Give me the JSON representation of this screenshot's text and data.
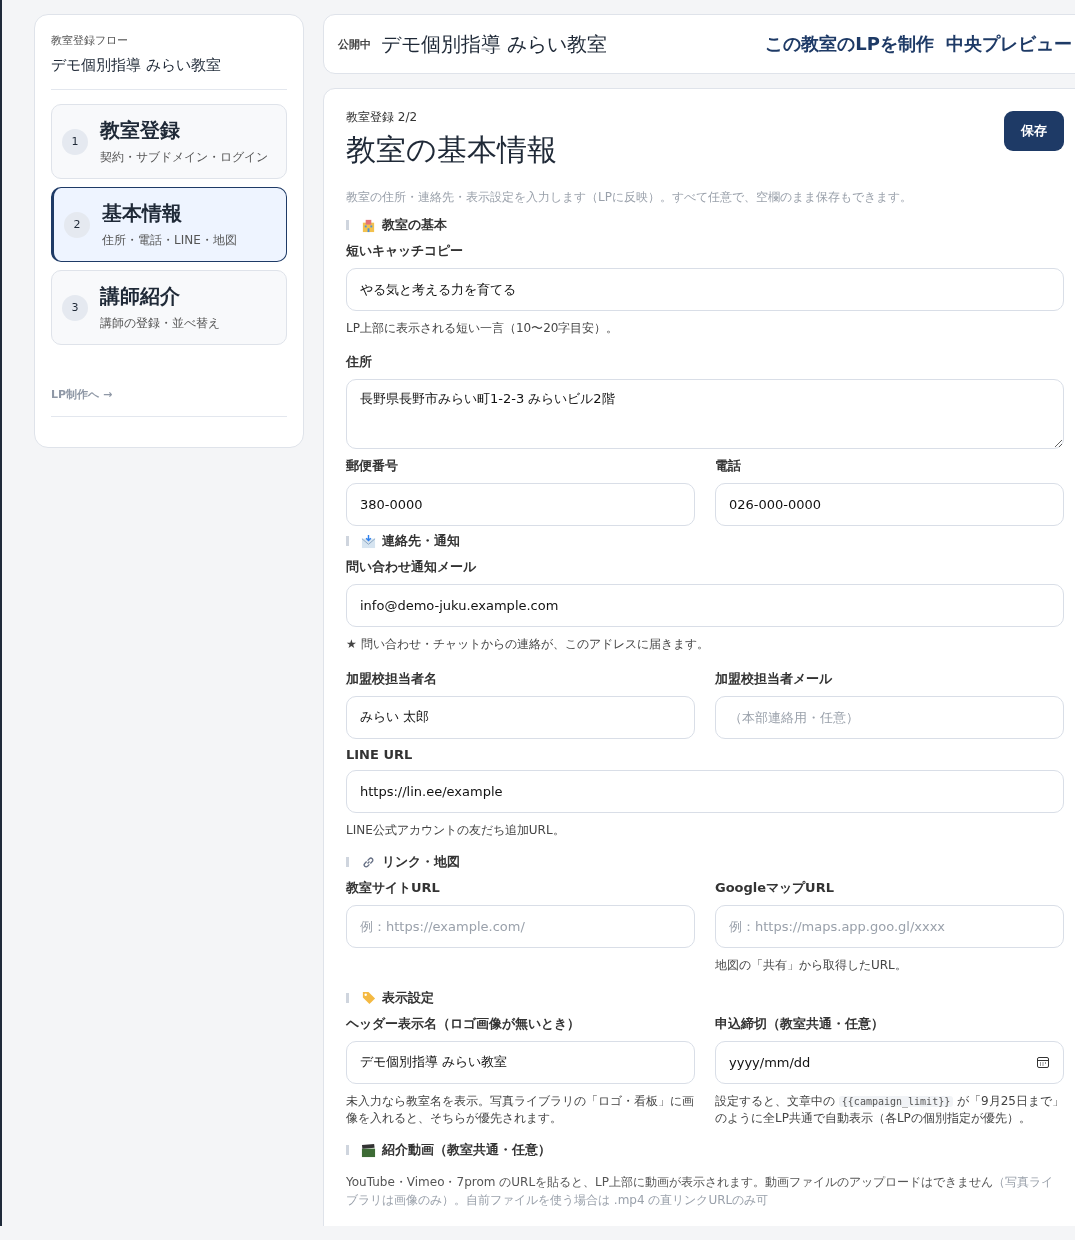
{
  "sidebar": {
    "label": "教室登録フロー",
    "school_name": "デモ個別指導 みらい教室",
    "steps": [
      {
        "number": "1",
        "title": "教室登録",
        "subtitle": "契約・サブドメイン・ログイン",
        "selected": false
      },
      {
        "number": "2",
        "title": "基本情報",
        "subtitle": "住所・電話・LINE・地図",
        "selected": true
      },
      {
        "number": "3",
        "title": "講師紹介",
        "subtitle": "講師の登録・並べ替え",
        "selected": false
      }
    ],
    "next_link": {
      "label": "LP制作へ →",
      "disabled": true
    }
  },
  "header": {
    "status": "公開中",
    "school_name": "デモ個別指導 みらい教室",
    "actions": [
      "この教室のLPを制作",
      "中央プレビュー"
    ]
  },
  "form": {
    "step": "教室登録 2/2",
    "title": "教室の基本情報",
    "save_button": "保存",
    "description": "教室の住所・連絡先・表示設定を入力します（LPに反映）。すべて任意で、空欄のまま保存もできます。",
    "sections": [
      {
        "kind": "school",
        "title": "教室の基本",
        "rows": [
          [
            {
              "kind": "input",
              "label": "短いキャッチコピー",
              "value": "やる気と考える力を育てる",
              "hint": [
                {
                  "kind": "text",
                  "text": "LP上部に表示される短い一言（10〜20字目安）。"
                }
              ]
            }
          ],
          [
            {
              "kind": "textarea",
              "label": "住所",
              "value": "長野県長野市みらい町1-2-3 みらいビル2階"
            }
          ],
          [
            {
              "kind": "input",
              "label": "郵便番号",
              "value": "380-0000"
            },
            {
              "kind": "input",
              "label": "電話",
              "value": "026-000-0000"
            }
          ]
        ]
      },
      {
        "kind": "mail",
        "title": "連絡先・通知",
        "rows": [
          [
            {
              "kind": "input",
              "label": "問い合わせ通知メール",
              "value": "info@demo-juku.example.com",
              "hint": [
                {
                  "kind": "text",
                  "text": "★ 問い合わせ・チャットからの連絡が、このアドレスに届きます。"
                }
              ]
            }
          ],
          [
            {
              "kind": "input",
              "label": "加盟校担当者名",
              "value": "みらい 太郎"
            },
            {
              "kind": "input",
              "label": "加盟校担当者メール",
              "placeholder": "（本部連絡用・任意）"
            }
          ],
          [
            {
              "kind": "input",
              "label": "LINE URL",
              "value": "https://lin.ee/example",
              "hint": [
                {
                  "kind": "text",
                  "text": "LINE公式アカウントの友だち追加URL。"
                }
              ]
            }
          ]
        ]
      },
      {
        "kind": "link",
        "title": "リンク・地図",
        "rows": [
          [
            {
              "kind": "input",
              "label": "教室サイトURL",
              "placeholder": "例：https://example.com/"
            },
            {
              "kind": "input",
              "label": "GoogleマップURL",
              "placeholder": "例：https://maps.app.goo.gl/xxxx",
              "hint": [
                {
                  "kind": "text",
                  "text": "地図の「共有」から取得したURL。"
                }
              ]
            }
          ]
        ]
      },
      {
        "kind": "tag",
        "title": "表示設定",
        "rows": [
          [
            {
              "kind": "input",
              "label": "ヘッダー表示名（ロゴ画像が無いとき）",
              "value": "デモ個別指導 みらい教室",
              "hint": [
                {
                  "kind": "text",
                  "text": "未入力なら教室名を表示。写真ライブラリの「ロゴ・看板」に画像を入れると、そちらが優先されます。"
                }
              ]
            },
            {
              "kind": "date",
              "label": "申込締切（教室共通・任意）",
              "value": "yyyy/mm/dd",
              "hint": [
                {
                  "kind": "text",
                  "text": "設定すると、文章中の "
                },
                {
                  "kind": "code",
                  "text": "{{campaign_limit}}"
                },
                {
                  "kind": "text",
                  "text": " が「9月25日まで」のように全LP共通で自動表示（各LPの個別指定が優先）。"
                }
              ]
            }
          ]
        ]
      },
      {
        "kind": "video",
        "title": "紹介動画（教室共通・任意）",
        "description": "YouTube・Vimeo・7prom のURLを貼ると、LP上部に動画が表示されます。動画ファイルのアップロードはできません",
        "note": "（写真ライブラリは画像のみ）。自前ファイルを使う場合は .mp4 の直リンクURLのみ可"
      }
    ]
  }
}
